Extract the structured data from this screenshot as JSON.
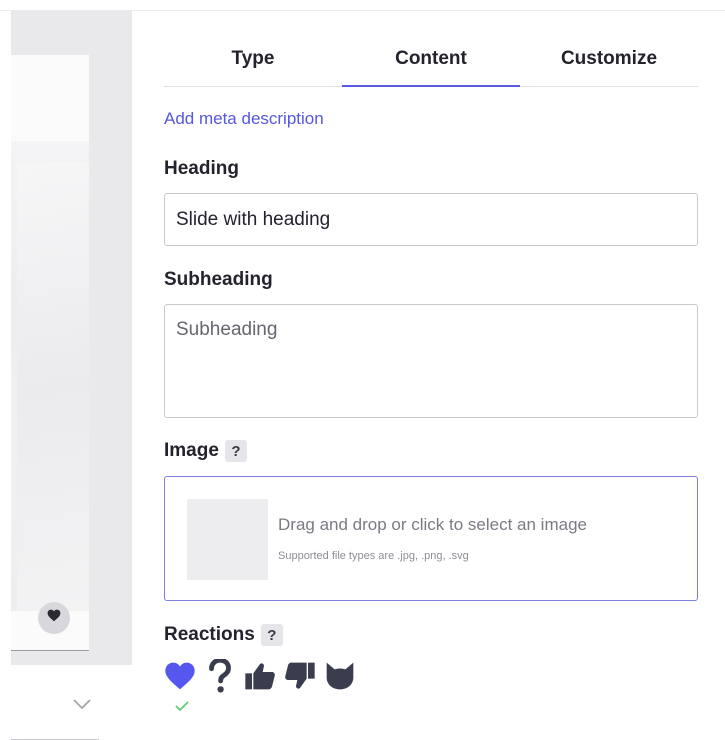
{
  "tabs": [
    {
      "label": "Type"
    },
    {
      "label": "Content"
    },
    {
      "label": "Customize"
    }
  ],
  "active_tab": "Content",
  "meta_link": "Add meta description",
  "heading": {
    "label": "Heading",
    "value": "Slide with heading"
  },
  "subheading": {
    "label": "Subheading",
    "placeholder": "Subheading"
  },
  "image": {
    "label": "Image",
    "help": "?",
    "drop_text": "Drag and drop or click to select an image",
    "supported_text": "Supported file types are .jpg, .png, .svg"
  },
  "reactions": {
    "label": "Reactions",
    "help": "?",
    "icons": [
      "heart-icon",
      "question-icon",
      "thumbs-up-icon",
      "thumbs-down-icon",
      "cat-icon"
    ],
    "selected": "heart-icon"
  },
  "colors": {
    "accent": "#5b5ce6",
    "link": "#5557dd",
    "heart": "#5557ee",
    "icon_dark": "#3a3d4d",
    "check": "#5ccf7a"
  }
}
